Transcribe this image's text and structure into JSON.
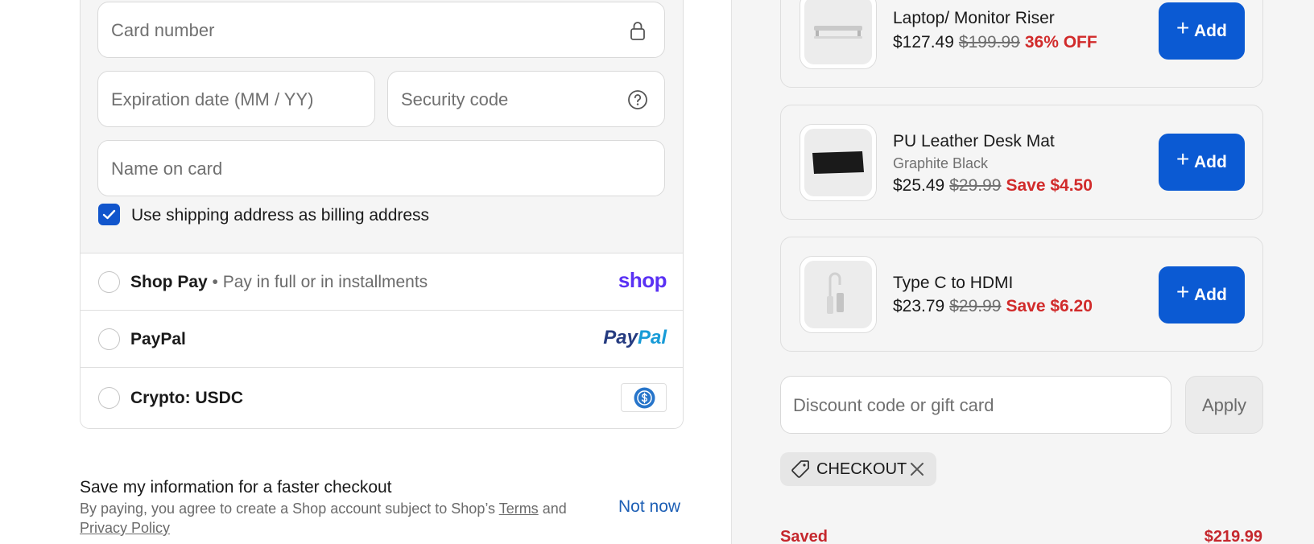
{
  "payment": {
    "card_number_placeholder": "Card number",
    "expiration_placeholder": "Expiration date (MM / YY)",
    "security_placeholder": "Security code",
    "name_placeholder": "Name on card",
    "billing_checkbox_label": "Use shipping address as billing address",
    "billing_checked": true,
    "options": [
      {
        "name": "Shop Pay",
        "detail": " • Pay in full or in installments",
        "logo_text": "shop",
        "icon": "shop-pay-logo"
      },
      {
        "name": "PayPal",
        "detail": "",
        "logo_text_1": "Pay",
        "logo_text_2": "Pal",
        "icon": "paypal-logo"
      },
      {
        "name": "Crypto: USDC",
        "detail": "",
        "icon": "usdc-icon"
      }
    ]
  },
  "save_info": {
    "title": "Save my information for a faster checkout",
    "text_before": "By paying, you agree to create a Shop account subject to Shop’s ",
    "terms_link": "Terms",
    "text_and": " and",
    "privacy_link": "Privacy Policy",
    "not_now": "Not now"
  },
  "products": [
    {
      "name": "Laptop/ Monitor Riser",
      "variant": "",
      "price": "$127.49",
      "compare_price": "$199.99",
      "discount": "36% OFF",
      "add_label": "Add"
    },
    {
      "name": "PU Leather Desk Mat",
      "variant": "Graphite Black",
      "price": "$25.49",
      "compare_price": "$29.99",
      "discount": "Save $4.50",
      "add_label": "Add"
    },
    {
      "name": "Type C to HDMI",
      "variant": "",
      "price": "$23.79",
      "compare_price": "$29.99",
      "discount": "Save $6.20",
      "add_label": "Add"
    }
  ],
  "discount": {
    "placeholder": "Discount code or gift card",
    "apply_label": "Apply",
    "applied_code": "CHECKOUT"
  },
  "summary": {
    "saved_label": "Saved",
    "saved_value": "$219.99"
  },
  "colors": {
    "accent_blue": "#0b5ad3",
    "sale_red": "#d12b2b",
    "shop_purple": "#5a31f4"
  }
}
